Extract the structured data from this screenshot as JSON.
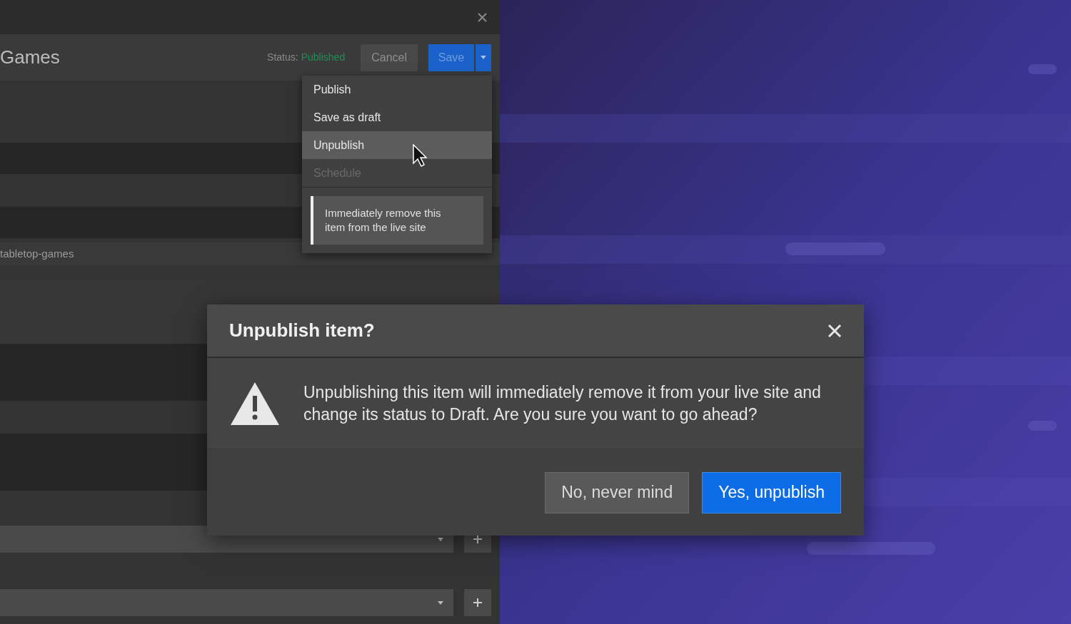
{
  "editor": {
    "title": "Games",
    "status_label": "Status:",
    "status_value": "Published",
    "cancel": "Cancel",
    "save": "Save",
    "slug": "tabletop-games"
  },
  "menu": {
    "items": [
      {
        "label": "Publish",
        "selected": false,
        "disabled": false
      },
      {
        "label": "Save as draft",
        "selected": false,
        "disabled": false
      },
      {
        "label": "Unpublish",
        "selected": true,
        "disabled": false
      },
      {
        "label": "Schedule",
        "selected": false,
        "disabled": true
      }
    ],
    "hint": "Immediately remove this item from the live site"
  },
  "dialog": {
    "title": "Unpublish item?",
    "message": "Unpublishing this item will immediately remove it from your live site and change its status to Draft. Are you sure you want to go ahead?",
    "buttons": [
      {
        "label": "No, never mind",
        "kind": "secondary"
      },
      {
        "label": "Yes, unpublish",
        "kind": "primary"
      }
    ]
  }
}
